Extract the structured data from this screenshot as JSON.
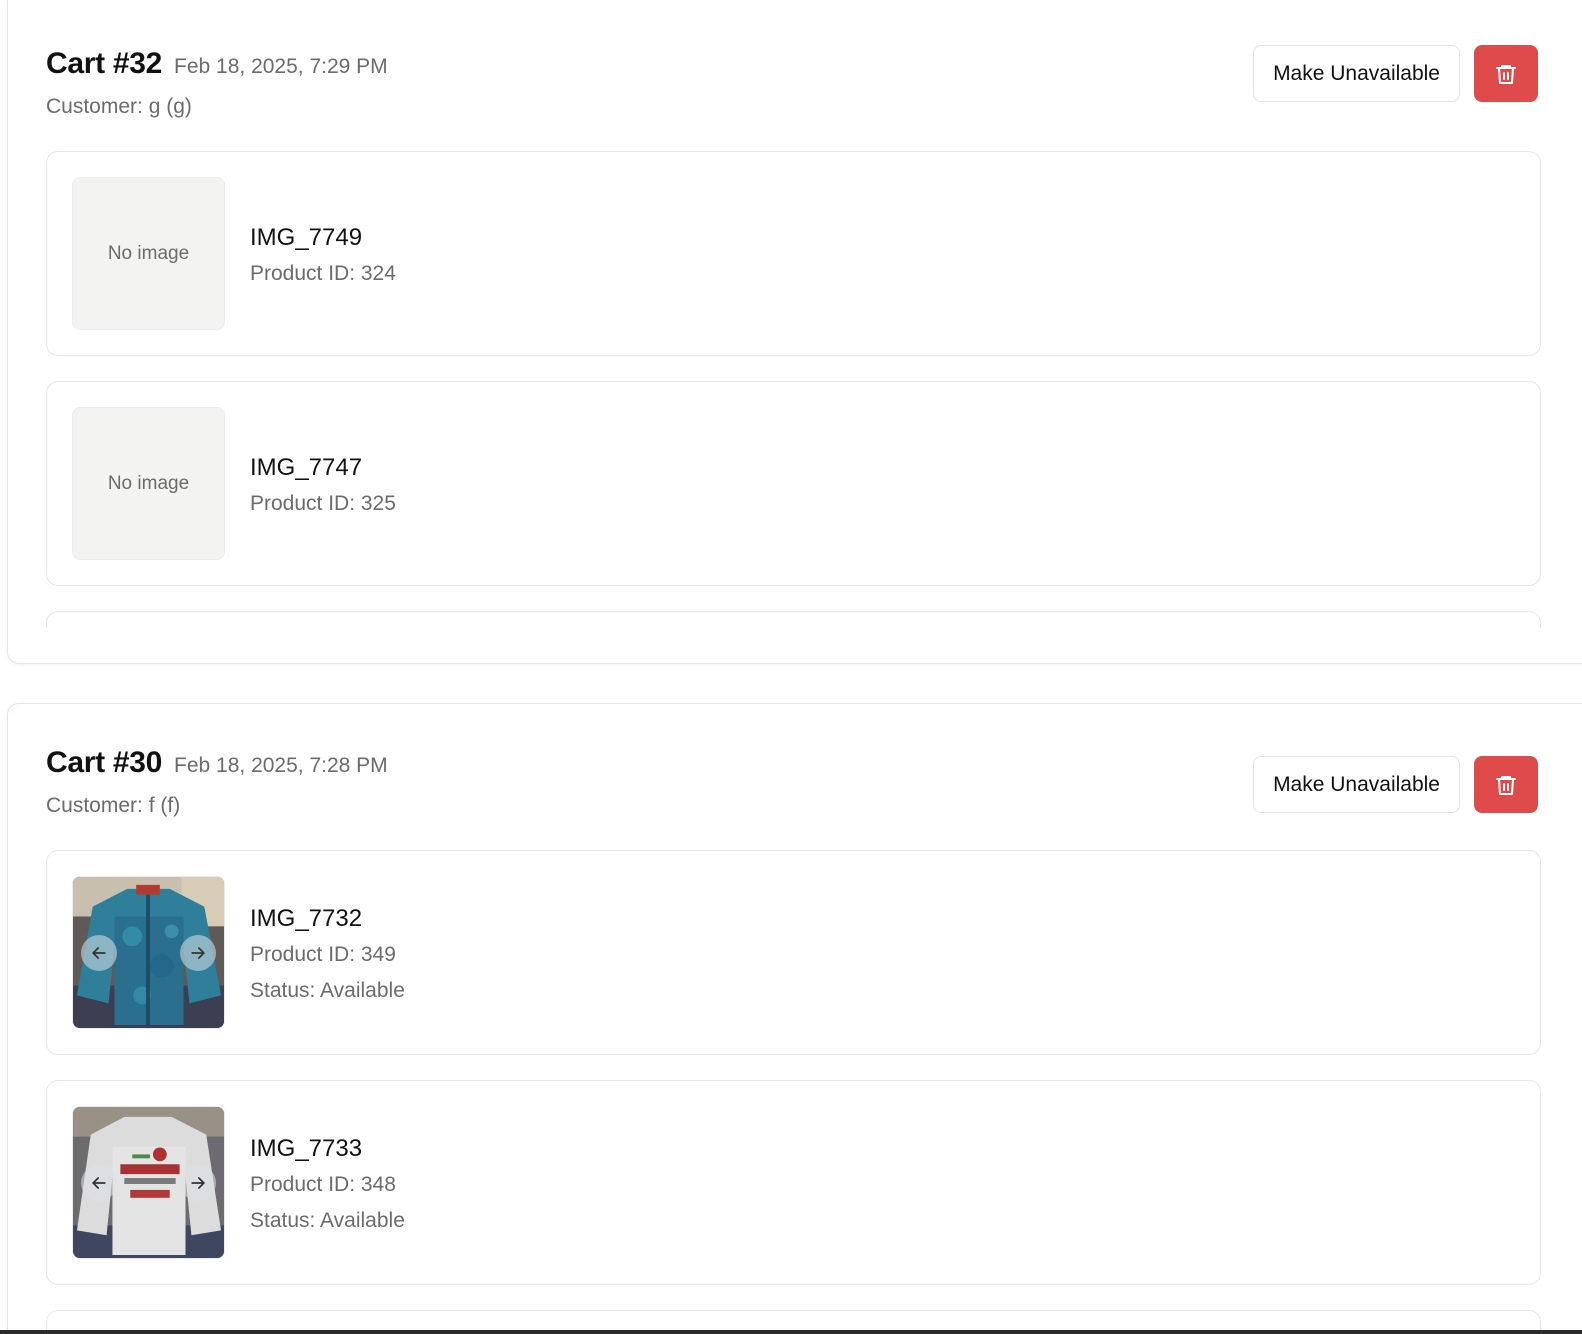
{
  "carts": [
    {
      "title": "Cart #32",
      "date": "Feb 18, 2025, 7:29 PM",
      "customer": "Customer: g (g)",
      "make_unavailable_label": "Make Unavailable",
      "items": [
        {
          "name": "IMG_7749",
          "product_id": "Product ID: 324",
          "no_image_text": "No image"
        },
        {
          "name": "IMG_7747",
          "product_id": "Product ID: 325",
          "no_image_text": "No image"
        }
      ]
    },
    {
      "title": "Cart #30",
      "date": "Feb 18, 2025, 7:28 PM",
      "customer": "Customer: f (f)",
      "make_unavailable_label": "Make Unavailable",
      "items": [
        {
          "name": "IMG_7732",
          "product_id": "Product ID: 349",
          "status": "Status: Available",
          "image": "blue-knit-jacket-photo"
        },
        {
          "name": "IMG_7733",
          "product_id": "Product ID: 348",
          "status": "Status: Available",
          "image": "grey-ohio-state-sweatshirt-photo"
        }
      ]
    }
  ],
  "icons": {
    "delete": "trash-icon",
    "prev": "arrow-left-icon",
    "next": "arrow-right-icon"
  },
  "colors": {
    "delete_button": "#df4b4b",
    "muted_text": "#6b6b6b",
    "border": "#e6e6e6",
    "placeholder_bg": "#f3f3f2"
  }
}
